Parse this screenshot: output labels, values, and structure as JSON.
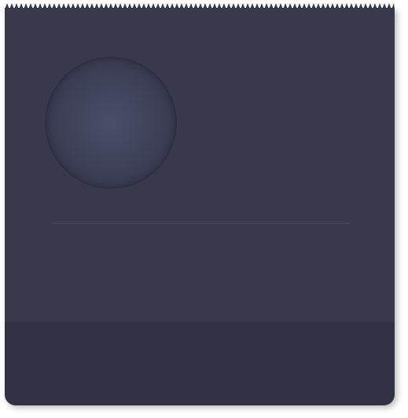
{
  "card": {
    "background_color": "#383a4c",
    "footer_color": "#313345",
    "divider_color": "#47495d"
  },
  "avatar": {
    "icon": "placeholder-avatar-circle"
  }
}
